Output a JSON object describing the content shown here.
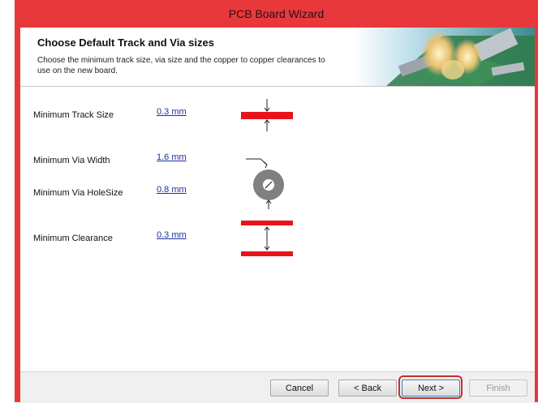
{
  "window": {
    "title": "PCB Board Wizard"
  },
  "header": {
    "title": "Choose Default Track and Via sizes",
    "description": "Choose the minimum track size, via size and the copper to copper clearances to use on the new board."
  },
  "fields": [
    {
      "label": "Minimum Track Size",
      "value": "0.3 mm"
    },
    {
      "label": "Minimum Via Width",
      "value": "1.6 mm"
    },
    {
      "label": "Minimum Via HoleSize",
      "value": "0.8 mm"
    },
    {
      "label": "Minimum Clearance",
      "value": "0.3 mm"
    }
  ],
  "buttons": {
    "cancel": "Cancel",
    "back": "< Back",
    "next": "Next >",
    "finish": "Finish"
  },
  "colors": {
    "track": "#e8141a",
    "frame": "#e8383c",
    "via": "#808080"
  }
}
